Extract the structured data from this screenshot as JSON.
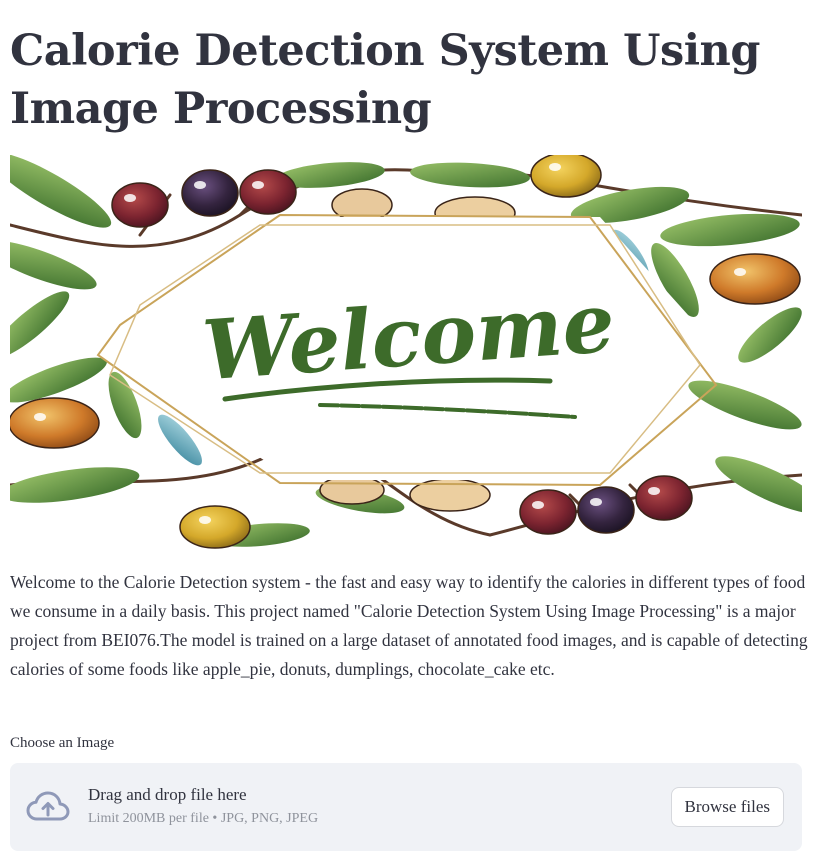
{
  "page": {
    "title": "Calorie Detection System Using Image Processing"
  },
  "hero": {
    "welcome_text": "Welcome",
    "icons": [
      "olive-branch-icon",
      "olive-icon",
      "leaf-icon"
    ]
  },
  "description": "Welcome to the Calorie Detection system - the fast and easy way to identify the calories in different types of food we consume in a daily basis. This project named \"Calorie Detection System Using Image Processing\" is a major project from BEI076.The model is trained on a large dataset of annotated food images, and is capable of detecting calories of some foods like apple_pie, donuts, dumplings, chocolate_cake etc.",
  "uploader": {
    "label": "Choose an Image",
    "drag_text": "Drag and drop file here",
    "limit_text": "Limit 200MB per file • JPG, PNG, JPEG",
    "browse_label": "Browse files",
    "icon": "cloud-upload-icon"
  },
  "colors": {
    "text": "#31333f",
    "dropzone_bg": "#f0f2f6",
    "muted_text": "#8f939c",
    "leaf_green": "#4e8a3a",
    "frame_gold": "#c9a45a",
    "welcome_green": "#3d6b2a"
  }
}
